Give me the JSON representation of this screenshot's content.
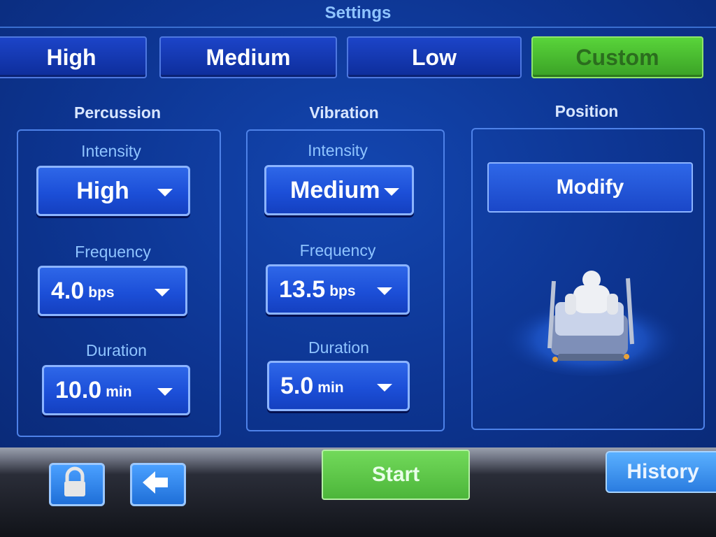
{
  "header": {
    "title": "Settings"
  },
  "presets": [
    {
      "label": "High",
      "active": false
    },
    {
      "label": "Medium",
      "active": false
    },
    {
      "label": "Low",
      "active": false
    },
    {
      "label": "Custom",
      "active": true
    }
  ],
  "percussion": {
    "title": "Percussion",
    "intensity": {
      "label": "Intensity",
      "value": "High"
    },
    "frequency": {
      "label": "Frequency",
      "value": "4.0",
      "unit": "bps"
    },
    "duration": {
      "label": "Duration",
      "value": "10.0",
      "unit": "min"
    }
  },
  "vibration": {
    "title": "Vibration",
    "intensity": {
      "label": "Intensity",
      "value": "Medium"
    },
    "frequency": {
      "label": "Frequency",
      "value": "13.5",
      "unit": "bps"
    },
    "duration": {
      "label": "Duration",
      "value": "5.0",
      "unit": "min"
    }
  },
  "position": {
    "title": "Position",
    "modify_label": "Modify",
    "image_icon": "patient-bed-icon"
  },
  "footer": {
    "lock_icon": "lock-icon",
    "back_icon": "back-arrow-icon",
    "start_label": "Start",
    "history_label": "History"
  },
  "colors": {
    "accent_green": "#4cb63a",
    "panel_blue": "#1c4fd8",
    "label_blue": "#8fc4ff"
  }
}
